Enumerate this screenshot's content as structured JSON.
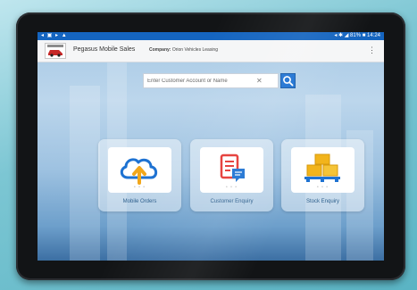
{
  "statusbar": {
    "left_icons": "◂ ▣ ▸ ▲",
    "right": "◂ ✱ ◢ 81% ■ 14:24"
  },
  "app": {
    "title": "Pegasus Mobile Sales",
    "company_label": "Company:",
    "company_value": "Orion Vehicles Leasing",
    "menu_icon": "more-vert-icon"
  },
  "search": {
    "placeholder": "Enter Customer Account or Name",
    "value": "",
    "clear_icon": "clear-icon",
    "button_icon": "search-icon"
  },
  "tiles": [
    {
      "label": "Mobile Orders",
      "icon": "cloud-upload-icon"
    },
    {
      "label": "Customer Enquiry",
      "icon": "document-chat-icon"
    },
    {
      "label": "Stock Enquiry",
      "icon": "stacked-boxes-icon"
    }
  ],
  "colors": {
    "statusbar": "#1565c0",
    "accent": "#1e72d2",
    "tile_label": "#2e5f8c",
    "enquiry_red": "#e53935",
    "boxes_yellow": "#f2b41b"
  }
}
